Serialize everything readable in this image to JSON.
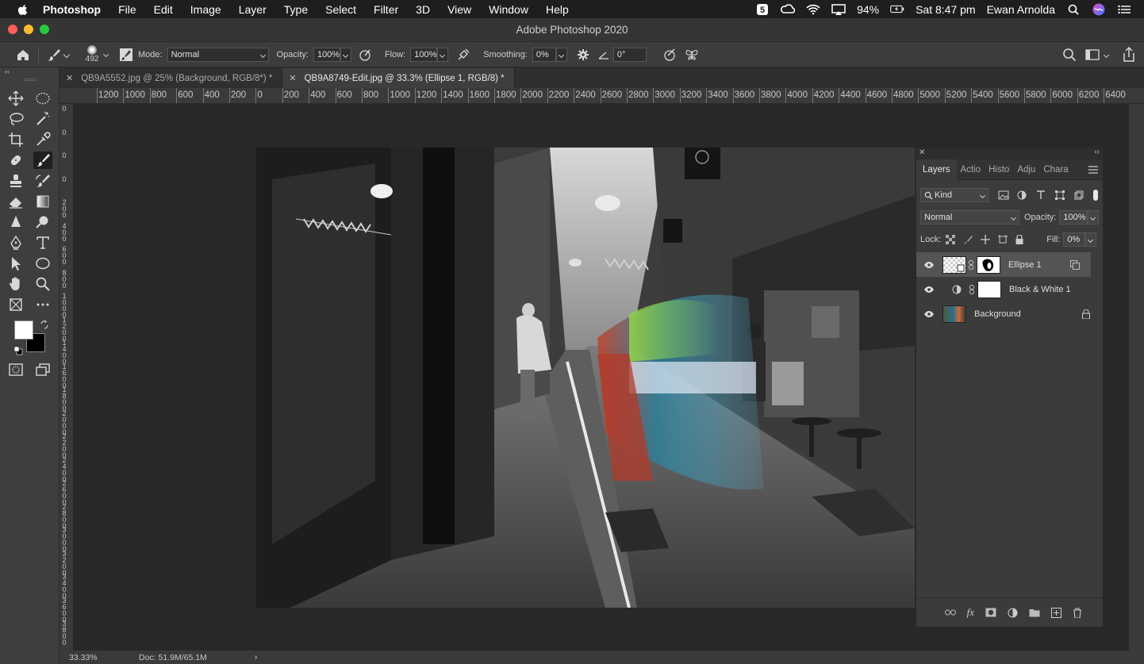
{
  "menubar": {
    "app": "Photoshop",
    "items": [
      "File",
      "Edit",
      "Image",
      "Layer",
      "Type",
      "Select",
      "Filter",
      "3D",
      "View",
      "Window",
      "Help"
    ],
    "battery": "94%",
    "datetime": "Sat 8:47 pm",
    "user": "Ewan Arnolda"
  },
  "window": {
    "title": "Adobe Photoshop 2020"
  },
  "options": {
    "brush_size": "492",
    "mode_label": "Mode:",
    "mode_value": "Normal",
    "opacity_label": "Opacity:",
    "opacity_value": "100%",
    "flow_label": "Flow:",
    "flow_value": "100%",
    "smoothing_label": "Smoothing:",
    "smoothing_value": "0%",
    "angle_value": "0°"
  },
  "tabs": [
    {
      "label": "QB9A5552.jpg @ 25% (Background, RGB/8*) *"
    },
    {
      "label": "QB9A8749-Edit.jpg @ 33.3% (Ellipse 1, RGB/8) *"
    }
  ],
  "ruler": {
    "top_labels": [
      "1200",
      "1000",
      "800",
      "600",
      "400",
      "200",
      "0",
      "200",
      "400",
      "600",
      "800",
      "1000",
      "1200",
      "1400",
      "1600",
      "1800",
      "2000",
      "2200",
      "2400",
      "2600",
      "2800",
      "3000",
      "3200",
      "3400",
      "3600",
      "3800",
      "4000",
      "4200",
      "4400",
      "4600",
      "4800",
      "5000",
      "5200",
      "5400",
      "5600",
      "5800",
      "6000",
      "6200",
      "6400"
    ],
    "left_labels": [
      "0",
      "0",
      "0",
      "0",
      "2 0 0",
      "4 0 0",
      "6 0 0",
      "8 0 0",
      "1 0 0 0",
      "1 2 0 0",
      "1 4 0 0",
      "1 6 0 0",
      "1 8 0 0",
      "2 0 0 0",
      "2 2 0 0",
      "2 4 0 0",
      "2 6 0 0",
      "2 8 0 0",
      "3 0 0 0",
      "3 2 0 0",
      "3 4 0 0",
      "3 6 0 0",
      "3 8 0 0"
    ]
  },
  "status": {
    "zoom": "33.33%",
    "doc": "Doc: 51.9M/65.1M"
  },
  "layers_panel": {
    "tabs": [
      "Layers",
      "Actio",
      "Histo",
      "Adju",
      "Chara"
    ],
    "filter_kind": "Kind",
    "blend_mode": "Normal",
    "opacity_label": "Opacity:",
    "opacity_value": "100%",
    "lock_label": "Lock:",
    "fill_label": "Fill:",
    "fill_value": "0%",
    "layers": [
      {
        "name": "Ellipse 1"
      },
      {
        "name": "Black & White 1"
      },
      {
        "name": "Background"
      }
    ]
  },
  "colors": {
    "menubar_bg": "#1e1e1e",
    "panel_bg": "#3b3b3b",
    "canvas_bg": "#282828",
    "foreground_color": "#ffffff",
    "background_color": "#000000"
  }
}
